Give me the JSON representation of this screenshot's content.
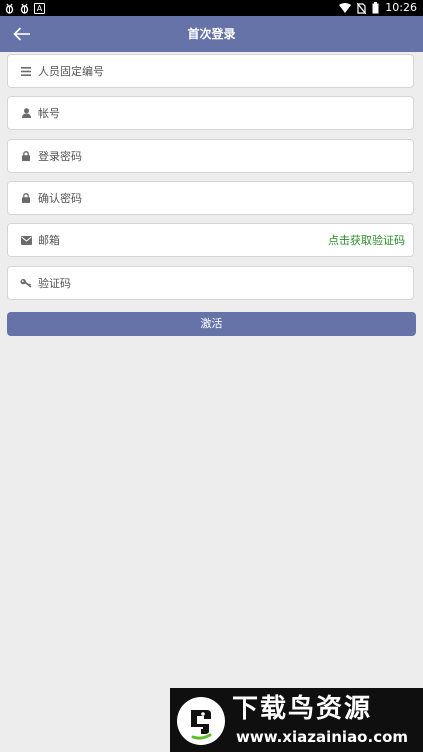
{
  "status_bar": {
    "left_icons": [
      "bug-icon",
      "bug-icon",
      "notification-a-icon"
    ],
    "notif_letter": "A",
    "right_icons": [
      "wifi-icon",
      "no-sim-icon",
      "battery-icon"
    ],
    "time": "10:26",
    "background": "#000000"
  },
  "header": {
    "back_icon": "back-arrow-icon",
    "title": "首次登录",
    "background": "#6673a8"
  },
  "form": {
    "fields": [
      {
        "icon": "list-icon",
        "placeholder": "人员固定编号"
      },
      {
        "icon": "user-icon",
        "placeholder": "帐号"
      },
      {
        "icon": "lock-icon",
        "placeholder": "登录密码"
      },
      {
        "icon": "lock-icon",
        "placeholder": "确认密码"
      },
      {
        "icon": "envelope-icon",
        "placeholder": "邮箱",
        "action_label": "点击获取验证码"
      },
      {
        "icon": "key-icon",
        "placeholder": "验证码"
      }
    ],
    "submit_label": "激活",
    "accent_color": "#6673a8",
    "link_color": "#2e8b2e"
  },
  "watermark": {
    "title": "下载鸟资源",
    "url": "www.xiazainiao.com"
  }
}
